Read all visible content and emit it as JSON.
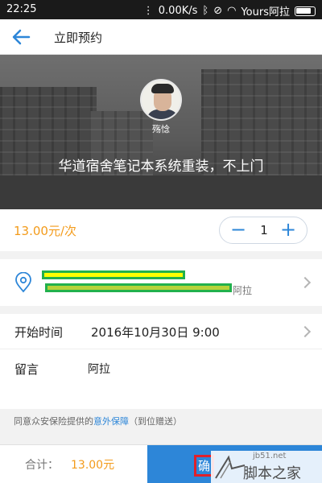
{
  "status_bar": {
    "time": "22:25",
    "network_speed": "0.00K/s",
    "carrier": "Yours阿拉"
  },
  "nav": {
    "title": "立即预约",
    "back_icon": "back-arrow-icon"
  },
  "provider": {
    "name": "殇惗",
    "service_title": "华道宿舍笔记本系统重装，不上门"
  },
  "order": {
    "price": "13.00元/次",
    "quantity": "1",
    "minus_label": "−",
    "plus_label": "+"
  },
  "address": {
    "suffix": "阿拉"
  },
  "start_time": {
    "label": "开始时间",
    "value": "2016年10月30日 9:00"
  },
  "message": {
    "label": "留言",
    "value": "阿拉"
  },
  "insurance": {
    "prefix": "同意众安保险提供的",
    "link": "意外保障",
    "suffix": "（到位赠送）"
  },
  "footer": {
    "total_label": "合计：",
    "total_value": "13.00元",
    "confirm_label": "确"
  },
  "watermark": {
    "url": "jb51.net",
    "text": "脚本之家"
  },
  "colors": {
    "accent_blue": "#2d86d8",
    "price_orange": "#f39b1b",
    "redaction_yellow": "#ffff00",
    "redaction_green": "#22b14c",
    "highlight_red": "#e0202a"
  }
}
